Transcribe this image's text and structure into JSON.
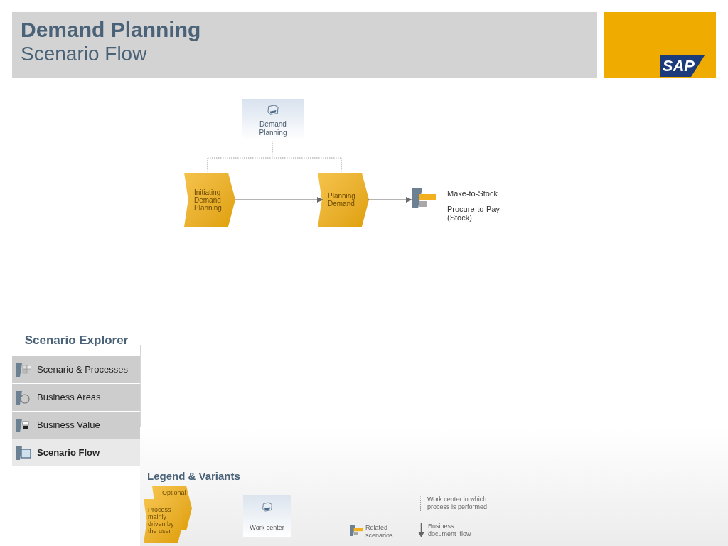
{
  "header": {
    "title": "Demand Planning",
    "subtitle": "Scenario Flow",
    "logo": "SAP"
  },
  "diagram": {
    "work_center": "Demand Planning",
    "steps": [
      "Initiating Demand Planning",
      "Planning Demand"
    ],
    "related_scenarios": [
      "Make-to-Stock",
      "Procure-to-Pay (Stock)"
    ]
  },
  "explorer": {
    "title": "Scenario Explorer",
    "items": [
      {
        "label": "Scenario & Processes",
        "selected": false,
        "kind": "processes"
      },
      {
        "label": "Business Areas",
        "selected": false,
        "kind": "areas"
      },
      {
        "label": "Business Value",
        "selected": false,
        "kind": "value"
      },
      {
        "label": "Scenario Flow",
        "selected": true,
        "kind": "flow"
      }
    ]
  },
  "legend": {
    "title": "Legend & Variants",
    "optional_process": "Optional",
    "user_process": "Process mainly driven by the user",
    "work_center": "Work center",
    "related_scenarios": "Related scenarios",
    "work_center_line": "Work center in which process is performed",
    "document_flow": "Business document  flow"
  }
}
